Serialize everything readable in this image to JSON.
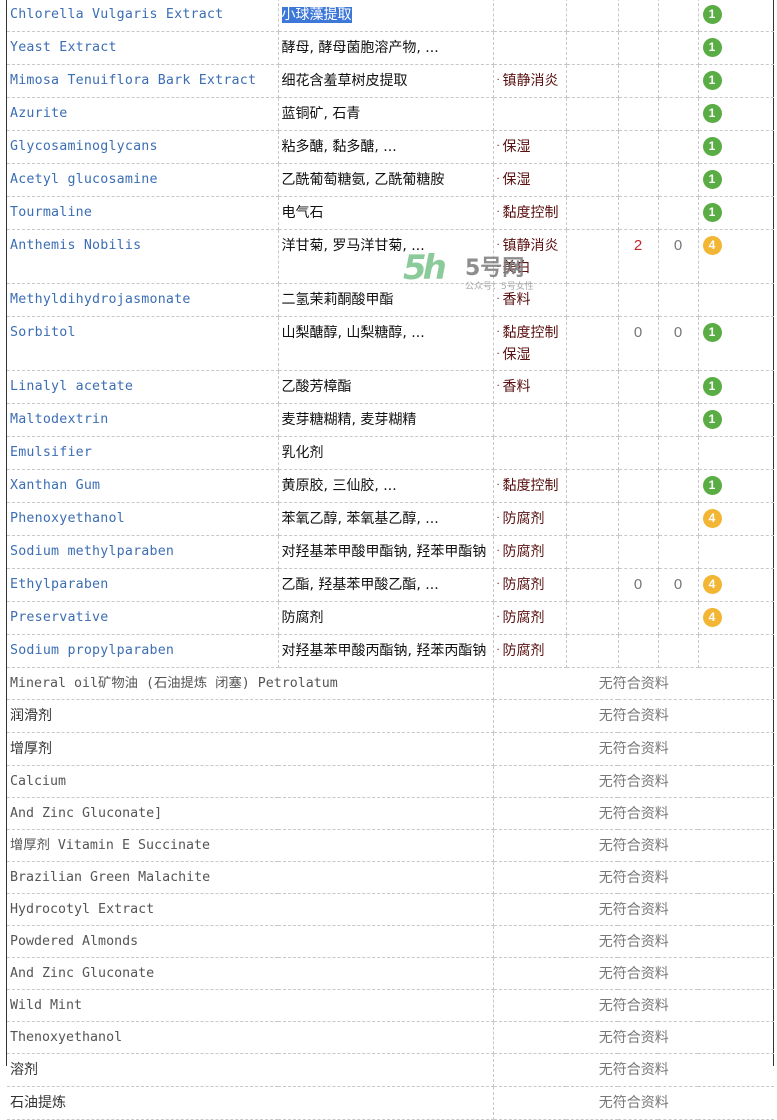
{
  "ingredients": [
    {
      "name": "Chlorella Vulgaris Extract",
      "cn": "小球藻提取",
      "cn_selected": true,
      "functions": [],
      "col4": "",
      "col5": "",
      "badge": "1",
      "badge_color": "#5aac44"
    },
    {
      "name": "Yeast Extract",
      "cn": "酵母, 酵母菌胞溶产物, ...",
      "functions": [],
      "col4": "",
      "col5": "",
      "badge": "1",
      "badge_color": "#5aac44"
    },
    {
      "name": "Mimosa Tenuiflora Bark Extract",
      "cn": "细花含羞草树皮提取",
      "functions": [
        "镇静消炎"
      ],
      "col4": "",
      "col5": "",
      "badge": "1",
      "badge_color": "#5aac44"
    },
    {
      "name": "Azurite",
      "cn": "蓝铜矿, 石青",
      "functions": [],
      "col4": "",
      "col5": "",
      "badge": "1",
      "badge_color": "#5aac44"
    },
    {
      "name": "Glycosaminoglycans",
      "cn": "粘多醣, 黏多醣, ...",
      "functions": [
        "保湿"
      ],
      "col4": "",
      "col5": "",
      "badge": "1",
      "badge_color": "#5aac44"
    },
    {
      "name": "Acetyl glucosamine",
      "cn": "乙酰葡萄糖氨, 乙酰葡糖胺",
      "functions": [
        "保湿"
      ],
      "col4": "",
      "col5": "",
      "badge": "1",
      "badge_color": "#5aac44"
    },
    {
      "name": "Tourmaline",
      "cn": "电气石",
      "functions": [
        "黏度控制"
      ],
      "col4": "",
      "col5": "",
      "badge": "1",
      "badge_color": "#5aac44"
    },
    {
      "name": "Anthemis Nobilis",
      "cn": "洋甘菊, 罗马洋甘菊, ...",
      "functions": [
        "镇静消炎",
        "美白"
      ],
      "col4": "2",
      "col4_red": true,
      "col5": "0",
      "badge": "4",
      "badge_color": "#f2b534"
    },
    {
      "name": "Methyldihydrojasmonate",
      "cn": "二氢茉莉酮酸甲酯",
      "functions": [
        "香料"
      ],
      "col4": "",
      "col5": "",
      "badge": "",
      "badge_color": ""
    },
    {
      "name": "Sorbitol",
      "cn": "山梨醣醇, 山梨糖醇, ...",
      "functions": [
        "黏度控制",
        "保湿"
      ],
      "col4": "0",
      "col5": "0",
      "badge": "1",
      "badge_color": "#5aac44"
    },
    {
      "name": "Linalyl acetate",
      "cn": "乙酸芳樟酯",
      "functions": [
        "香料"
      ],
      "col4": "",
      "col5": "",
      "badge": "1",
      "badge_color": "#5aac44"
    },
    {
      "name": "Maltodextrin",
      "cn": "麦芽糖糊精, 麦芽糊精",
      "functions": [],
      "col4": "",
      "col5": "",
      "badge": "1",
      "badge_color": "#5aac44"
    },
    {
      "name": "Emulsifier",
      "cn": "乳化剂",
      "functions": [],
      "col4": "",
      "col5": "",
      "badge": "",
      "badge_color": ""
    },
    {
      "name": "Xanthan Gum",
      "cn": "黄原胶, 三仙胶, ...",
      "functions": [
        "黏度控制"
      ],
      "col4": "",
      "col5": "",
      "badge": "1",
      "badge_color": "#5aac44"
    },
    {
      "name": "Phenoxyethanol",
      "cn": "苯氧乙醇, 苯氧基乙醇, ...",
      "functions": [
        "防腐剂"
      ],
      "col4": "",
      "col5": "",
      "badge": "4",
      "badge_color": "#f2b534"
    },
    {
      "name": "Sodium methylparaben",
      "cn": "对羟基苯甲酸甲酯钠, 羟苯甲酯钠",
      "functions": [
        "防腐剂"
      ],
      "col4": "",
      "col5": "",
      "badge": "",
      "badge_color": ""
    },
    {
      "name": "Ethylparaben",
      "cn": "乙酯, 羟基苯甲酸乙酯, ...",
      "functions": [
        "防腐剂"
      ],
      "col4": "0",
      "col5": "0",
      "badge": "4",
      "badge_color": "#f2b534"
    },
    {
      "name": "Preservative",
      "cn": "防腐剂",
      "functions": [
        "防腐剂"
      ],
      "col4": "",
      "col5": "",
      "badge": "4",
      "badge_color": "#f2b534"
    },
    {
      "name": "Sodium propylparaben",
      "cn": "对羟基苯甲酸丙酯钠, 羟苯丙酯钠",
      "functions": [
        "防腐剂"
      ],
      "col4": "",
      "col5": "",
      "badge": "",
      "badge_color": ""
    }
  ],
  "unmatched": {
    "no_data_label": "无符合资料",
    "items": [
      {
        "name": "Mineral oil矿物油 (石油提炼 闭塞) Petrolatum",
        "zh": false
      },
      {
        "name": "润滑剂",
        "zh": true
      },
      {
        "name": "增厚剂",
        "zh": true
      },
      {
        "name": "Calcium",
        "zh": false
      },
      {
        "name": "And Zinc Gluconate]",
        "zh": false
      },
      {
        "name": "增厚剂 Vitamin E Succinate",
        "zh": false
      },
      {
        "name": "Brazilian Green Malachite",
        "zh": false
      },
      {
        "name": "Hydrocotyl Extract",
        "zh": false
      },
      {
        "name": "Powdered Almonds",
        "zh": false
      },
      {
        "name": "And Zinc Gluconate",
        "zh": false
      },
      {
        "name": "Wild Mint",
        "zh": false
      },
      {
        "name": "Thenoxyethanol",
        "zh": false
      },
      {
        "name": "溶剂",
        "zh": true
      },
      {
        "name": "石油提炼",
        "zh": true
      }
    ]
  },
  "watermark": {
    "logo": "5h",
    "title": "5号网",
    "subtitle": "公众号：5号女性"
  }
}
